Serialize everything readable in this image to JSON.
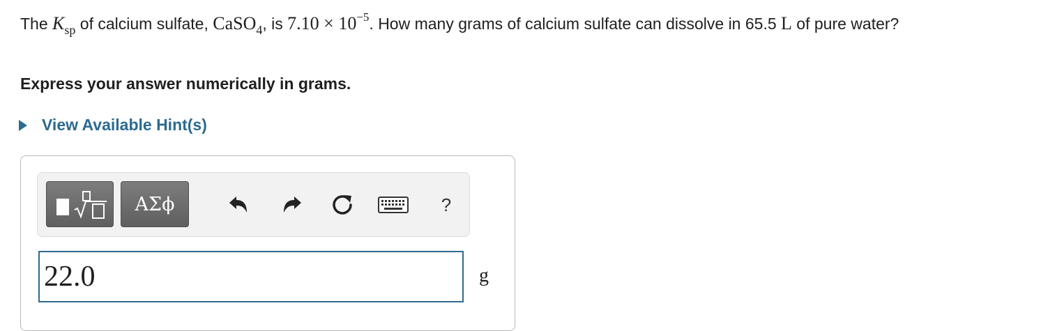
{
  "question": {
    "intro": "The ",
    "ksp_symbol": "K",
    "ksp_subscript": "sp",
    "part2": " of calcium sulfate, ",
    "formula_main": "CaSO",
    "formula_subscript": "4",
    "part3": ", is ",
    "value": "7.10 × 10",
    "exponent": "−5",
    "part4": ". How many grams of calcium sulfate can dissolve in 65.5 ",
    "volume_unit": "L",
    "part5": " of pure water?"
  },
  "instruction": "Express your answer numerically in grams.",
  "hint": {
    "label": "View Available Hint(s)"
  },
  "toolbar": {
    "greek_label": "ΑΣϕ",
    "undo_icon": "undo-icon",
    "redo_icon": "redo-icon",
    "reset_icon": "reset-icon",
    "keyboard_icon": "keyboard-icon",
    "help_label": "?"
  },
  "answer": {
    "value": "22.0",
    "unit": "g"
  }
}
